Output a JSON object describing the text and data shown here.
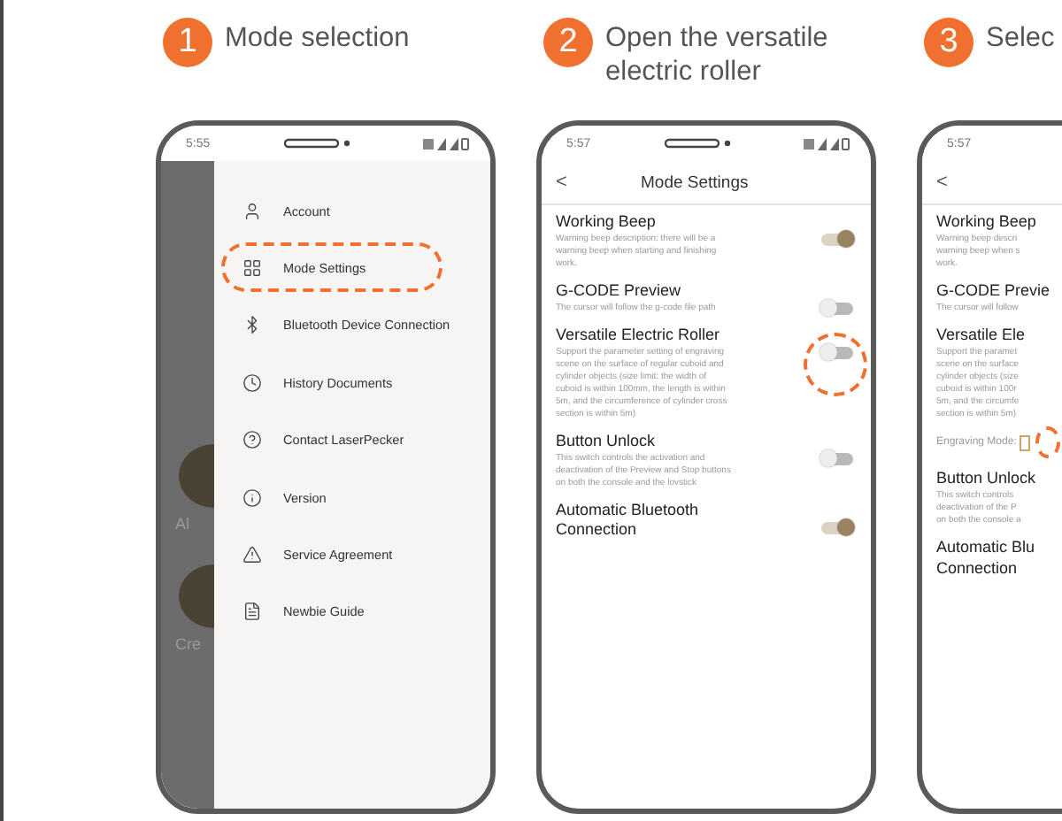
{
  "steps": [
    {
      "number": "1",
      "label_lines": [
        "Mode selection"
      ]
    },
    {
      "number": "2",
      "label_lines": [
        "Open the versatile",
        "electric roller"
      ]
    },
    {
      "number": "3",
      "label_lines": [
        "Selec"
      ]
    }
  ],
  "phones": [
    {
      "kind": "menu",
      "time": "5:55",
      "backdrop_labels": [
        "Al",
        "Cre"
      ],
      "items": [
        {
          "label": "Account",
          "highlighted": false
        },
        {
          "label": "Mode Settings",
          "highlighted": true
        },
        {
          "label": "Bluetooth Device Connection",
          "highlighted": false
        },
        {
          "label": "History Documents",
          "highlighted": false
        },
        {
          "label": "Contact LaserPecker",
          "highlighted": false
        },
        {
          "label": "Version",
          "highlighted": false
        },
        {
          "label": "Service Agreement",
          "highlighted": false
        },
        {
          "label": "Newbie Guide",
          "highlighted": false
        }
      ]
    },
    {
      "kind": "settings",
      "time": "5:57",
      "back": "<",
      "title": "Mode Settings",
      "items": [
        {
          "title": "Working Beep",
          "description_lines": [
            "Warning beep description: there will be a",
            "warning beep when starting and finishing",
            "work."
          ],
          "on": true,
          "highlighted": false
        },
        {
          "title": "G-CODE Preview",
          "description_lines": [
            "The cursor will follow the g-code file path"
          ],
          "on": false,
          "highlighted": false
        },
        {
          "title": "Versatile Electric Roller",
          "description_lines": [
            "Support the parameter setting of engraving",
            "scene on the surface of regular cuboid and",
            "cylinder objects (size limit: the width of",
            "cuboid is within 100mm, the length is within",
            "5m, and the circumference of cylinder cross",
            "section is within 5m)"
          ],
          "on": false,
          "highlighted": true
        },
        {
          "title": "Button Unlock",
          "description_lines": [
            "This switch controls the activation and",
            "deactivation of the Preview and Stop buttons",
            "on both the console and the lovstick"
          ],
          "on": false,
          "highlighted": false
        },
        {
          "title": "Automatic Bluetooth Connection",
          "on": true,
          "highlighted": false
        }
      ]
    },
    {
      "kind": "settings",
      "time": "5:57",
      "back": "<",
      "items": [
        {
          "title": "Working Beep",
          "description_lines": [
            "Warning beep descri",
            "warning beep when s",
            "work."
          ]
        },
        {
          "title": "G-CODE Previe",
          "description_lines": [
            "The cursor will follow"
          ]
        },
        {
          "title": "Versatile Ele",
          "description_lines": [
            "Support the paramet",
            "scene on the surface",
            "cylinder objects (size",
            "cuboid is within 100r",
            "5m, and the circumfe",
            "section is within 5m)"
          ],
          "mode_label": "Engraving Mode:",
          "highlighted": true
        },
        {
          "title": "Button Unlock",
          "description_lines": [
            "This switch controls",
            "deactivation of the P",
            "on both the console a"
          ]
        },
        {
          "title": "Automatic Blu",
          "title_line2": "Connection"
        }
      ]
    }
  ]
}
